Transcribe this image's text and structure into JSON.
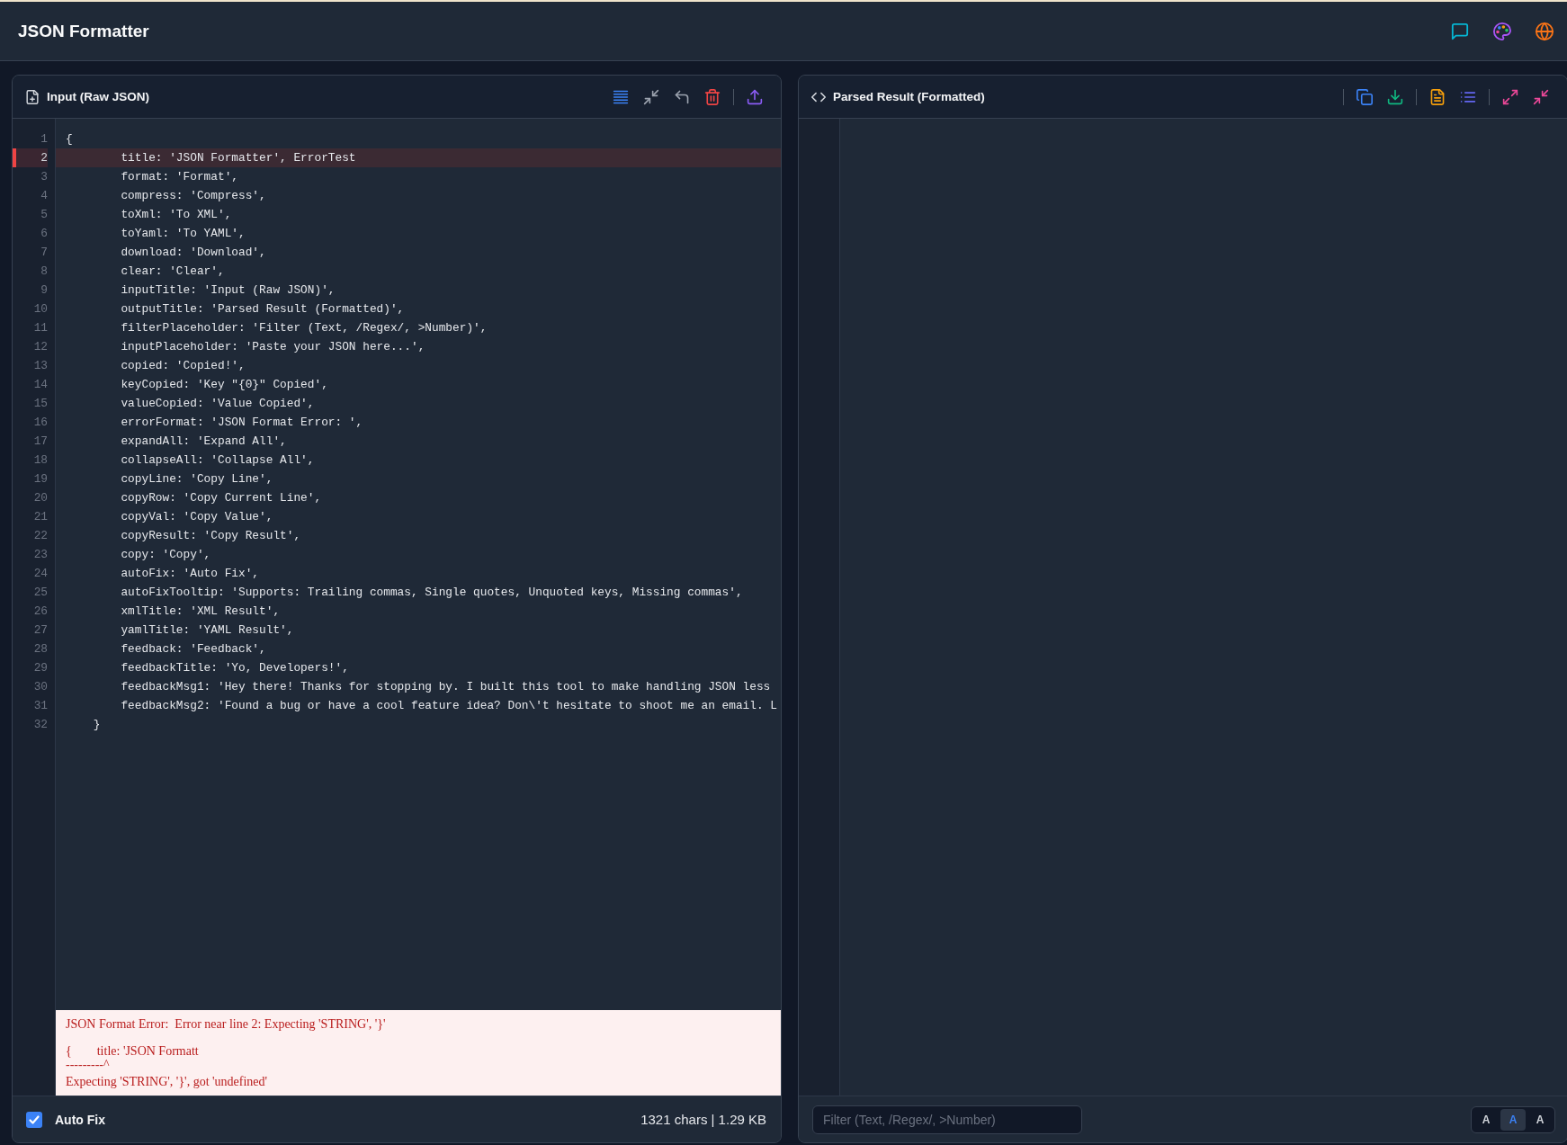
{
  "app": {
    "title": "JSON Formatter"
  },
  "input_panel": {
    "title": "Input (Raw JSON)",
    "lines": [
      {
        "number": "1",
        "text": "{",
        "error": false
      },
      {
        "number": "2",
        "text": "        title: 'JSON Formatter', ErrorTest",
        "error": true
      },
      {
        "number": "3",
        "text": "        format: 'Format',",
        "error": false
      },
      {
        "number": "4",
        "text": "        compress: 'Compress',",
        "error": false
      },
      {
        "number": "5",
        "text": "        toXml: 'To XML',",
        "error": false
      },
      {
        "number": "6",
        "text": "        toYaml: 'To YAML',",
        "error": false
      },
      {
        "number": "7",
        "text": "        download: 'Download',",
        "error": false
      },
      {
        "number": "8",
        "text": "        clear: 'Clear',",
        "error": false
      },
      {
        "number": "9",
        "text": "        inputTitle: 'Input (Raw JSON)',",
        "error": false
      },
      {
        "number": "10",
        "text": "        outputTitle: 'Parsed Result (Formatted)',",
        "error": false
      },
      {
        "number": "11",
        "text": "        filterPlaceholder: 'Filter (Text, /Regex/, >Number)',",
        "error": false
      },
      {
        "number": "12",
        "text": "        inputPlaceholder: 'Paste your JSON here...',",
        "error": false
      },
      {
        "number": "13",
        "text": "        copied: 'Copied!',",
        "error": false
      },
      {
        "number": "14",
        "text": "        keyCopied: 'Key \"{0}\" Copied',",
        "error": false
      },
      {
        "number": "15",
        "text": "        valueCopied: 'Value Copied',",
        "error": false
      },
      {
        "number": "16",
        "text": "        errorFormat: 'JSON Format Error: ',",
        "error": false
      },
      {
        "number": "17",
        "text": "        expandAll: 'Expand All',",
        "error": false
      },
      {
        "number": "18",
        "text": "        collapseAll: 'Collapse All',",
        "error": false
      },
      {
        "number": "19",
        "text": "        copyLine: 'Copy Line',",
        "error": false
      },
      {
        "number": "20",
        "text": "        copyRow: 'Copy Current Line',",
        "error": false
      },
      {
        "number": "21",
        "text": "        copyVal: 'Copy Value',",
        "error": false
      },
      {
        "number": "22",
        "text": "        copyResult: 'Copy Result',",
        "error": false
      },
      {
        "number": "23",
        "text": "        copy: 'Copy',",
        "error": false
      },
      {
        "number": "24",
        "text": "        autoFix: 'Auto Fix',",
        "error": false
      },
      {
        "number": "25",
        "text": "        autoFixTooltip: 'Supports: Trailing commas, Single quotes, Unquoted keys, Missing commas',",
        "error": false
      },
      {
        "number": "26",
        "text": "        xmlTitle: 'XML Result',",
        "error": false
      },
      {
        "number": "27",
        "text": "        yamlTitle: 'YAML Result',",
        "error": false
      },
      {
        "number": "28",
        "text": "        feedback: 'Feedback',",
        "error": false
      },
      {
        "number": "29",
        "text": "        feedbackTitle: 'Yo, Developers!',",
        "error": false
      },
      {
        "number": "30",
        "text": "        feedbackMsg1: 'Hey there! Thanks for stopping by. I built this tool to make handling JSON less",
        "error": false
      },
      {
        "number": "31",
        "text": "        feedbackMsg2: 'Found a bug or have a cool feature idea? Don\\'t hesitate to shoot me an email. L",
        "error": false
      },
      {
        "number": "32",
        "text": "    }",
        "error": false
      }
    ],
    "error": {
      "message": "JSON Format Error:  Error near line 2: Expecting 'STRING', '}'",
      "snippet": "{        title: 'JSON Formatt",
      "pointer": "---------^",
      "expected": "Expecting 'STRING', '}', got 'undefined'"
    },
    "auto_fix": {
      "label": "Auto Fix",
      "checked": true
    },
    "stats": "1321 chars | 1.29 KB"
  },
  "output_panel": {
    "title": "Parsed Result (Formatted)",
    "filter": {
      "placeholder": "Filter (Text, /Regex/, >Number)"
    },
    "font_sizes": [
      {
        "label": "A",
        "selected": false
      },
      {
        "label": "A",
        "selected": true
      },
      {
        "label": "A",
        "selected": false
      }
    ]
  }
}
